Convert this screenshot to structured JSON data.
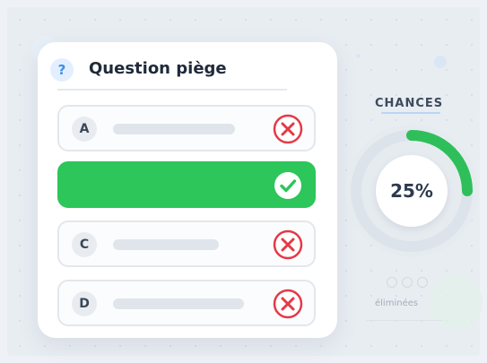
{
  "question": {
    "badge": "?",
    "title": "Question piège"
  },
  "options": [
    {
      "letter": "A",
      "state": "wrong",
      "icon": "x-circle-icon"
    },
    {
      "letter": "",
      "state": "correct",
      "icon": "check-circle-icon"
    },
    {
      "letter": "C",
      "state": "wrong",
      "icon": "x-circle-icon"
    },
    {
      "letter": "D",
      "state": "wrong",
      "icon": "x-circle-icon"
    }
  ],
  "chances": {
    "label": "CHANCES",
    "value": 0.25,
    "value_label": "25%"
  },
  "eliminated": {
    "label": "éliminées",
    "count_total": 3
  },
  "colors": {
    "correct": "#2cc65a",
    "wrong": "#e53946",
    "accent": "#3b8fe8",
    "gauge_track": "#dde3ea",
    "gauge_fill": "#2fbf5a"
  }
}
